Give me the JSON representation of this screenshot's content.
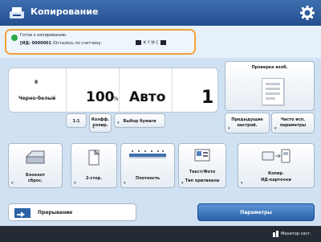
{
  "header": {
    "title": "Копирование",
    "title_icon": "copy-icon",
    "settings_icon": "gear-icon"
  },
  "status": {
    "line1": "Готов к копированию.",
    "code": "[ИД: 0000001",
    "line2": "/Осталось по счетчику:",
    "toner_label": "К  Y  М  С",
    "indicator_color": "#2ea84a",
    "highlight_color": "#f2a33a"
  },
  "main": {
    "color_mode_number": "8",
    "color_mode_label": "Черно-белый",
    "ratio_value": "100",
    "ratio_unit": "%",
    "paper_value": "Авто",
    "copies_value": "1"
  },
  "sub_buttons": {
    "one_to_one": "1:1",
    "zoom_line1": "Коэфф.",
    "zoom_line2": "копир.",
    "paper_select": "Выбор бумаги"
  },
  "preview": {
    "title": "Проверка изоб."
  },
  "settings": {
    "prev_line1": "Предыдущие",
    "prev_line2": "настрой.",
    "freq_line1": "Часто исп.",
    "freq_line2": "параметры"
  },
  "functions": [
    {
      "icon": "scanner-icon",
      "line1": "Блокнот",
      "line2": "сброс."
    },
    {
      "icon": "two-sided-icon",
      "line1": "2-стор.",
      "line2": ""
    },
    {
      "icon": "density-icon",
      "line1": "Плотность",
      "line2": ""
    },
    {
      "icon": "text-photo-icon",
      "line1": "Текст/Фото",
      "line2": "Тип оригинала"
    },
    {
      "icon": "id-card-icon",
      "line1": "Копир.",
      "line2": "ИД-карточки"
    }
  ],
  "bottom": {
    "interrupt_label": "Прерывание",
    "params_label": "Параметры",
    "system_monitor_label": "Монитор сост."
  },
  "colors": {
    "accent": "#2c62a8",
    "background": "#cfe1f2",
    "title_bar": "#234f8e"
  }
}
